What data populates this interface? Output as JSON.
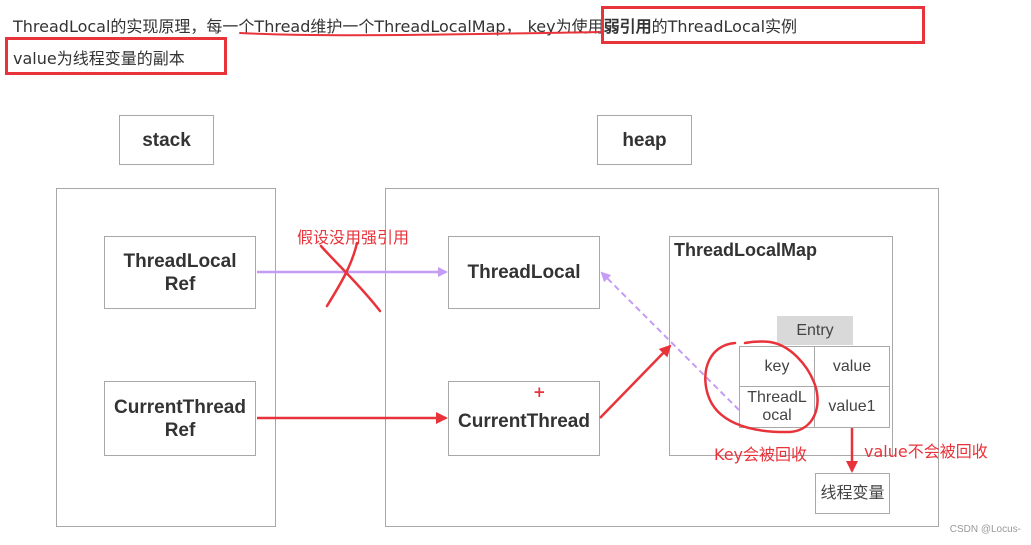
{
  "caption": {
    "line1_part1": "ThreadLocal的实现原理，",
    "line1_part2": "每一个Thread维护一个ThreadLocalMap，",
    "line1_part3_a": "key为使用",
    "line1_part3_bold": "弱引用",
    "line1_part3_b": "的ThreadLocal实例",
    "line2": "value为线程变量的副本"
  },
  "diagram": {
    "stack_label": "stack",
    "heap_label": "heap",
    "threadlocal_ref": [
      "ThreadLocal",
      "Ref"
    ],
    "currentthread_ref": [
      "CurrentThread",
      "Ref"
    ],
    "threadlocal": "ThreadLocal",
    "currentthread": "CurrentThread",
    "threadlocalmap": "ThreadLocalMap",
    "entry": "Entry",
    "key_header": "key",
    "value_header": "value",
    "key_cell": [
      "ThreadL",
      "ocal"
    ],
    "value_cell": "value1",
    "thread_var": "线程变量",
    "plus_mark": "+"
  },
  "annotations": {
    "no_strong_ref": "假设没用强引用",
    "key_collected": "Key会被回收",
    "value_not_collected": "value不会被回收"
  },
  "colors": {
    "red": "#e8333a",
    "purple": "#c59cf5",
    "border": "#a8a8a8",
    "entry_bg": "#d9d9d9"
  },
  "watermark": "CSDN @Locus-"
}
